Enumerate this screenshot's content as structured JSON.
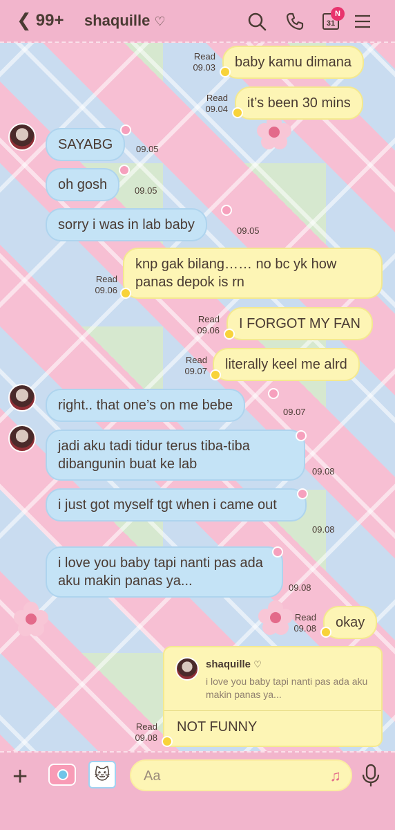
{
  "header": {
    "back_count": "99+",
    "contact_name": "shaquille",
    "calendar_day": "31",
    "calendar_badge": "N"
  },
  "messages": [
    {
      "id": "m1",
      "dir": "out",
      "text": "baby kamu dimana",
      "status": "Read",
      "time": "09.03"
    },
    {
      "id": "m2",
      "dir": "out",
      "text": "it’s been 30 mins",
      "status": "Read",
      "time": "09.04"
    },
    {
      "id": "m3",
      "dir": "in",
      "text": "SAYABG",
      "time": "09.05"
    },
    {
      "id": "m4",
      "dir": "in",
      "text": "oh gosh",
      "time": "09.05"
    },
    {
      "id": "m5",
      "dir": "in",
      "text": "sorry i was in lab baby",
      "time": "09.05"
    },
    {
      "id": "m6",
      "dir": "out",
      "text": "knp gak bilang…… no bc yk how panas depok is rn",
      "status": "Read",
      "time": "09.06"
    },
    {
      "id": "m7",
      "dir": "out",
      "text": "I FORGOT MY FAN",
      "status": "Read",
      "time": "09.06"
    },
    {
      "id": "m8",
      "dir": "out",
      "text": "literally keel me alrd",
      "status": "Read",
      "time": "09.07"
    },
    {
      "id": "m9",
      "dir": "in",
      "text": "right.. that one’s on me bebe",
      "time": "09.07"
    },
    {
      "id": "m10",
      "dir": "in",
      "text": "jadi aku tadi tidur terus tiba-tiba dibangunin buat ke lab",
      "time": "09.08"
    },
    {
      "id": "m11",
      "dir": "in",
      "text": "i just got myself tgt when i came out",
      "time": "09.08"
    },
    {
      "id": "m12",
      "dir": "in",
      "text": "i love you baby tapi nanti pas ada aku makin panas ya...",
      "time": "09.08"
    },
    {
      "id": "m13",
      "dir": "out",
      "text": "okay",
      "status": "Read",
      "time": "09.08"
    }
  ],
  "reply": {
    "quoted_name": "shaquille",
    "quoted_text": "i love you baby tapi nanti pas ada aku makin panas ya...",
    "text": "NOT FUNNY",
    "status": "Read",
    "time": "09.08"
  },
  "input": {
    "placeholder": "Aa"
  },
  "icons": {
    "back": "chevron-left-icon",
    "heart": "heart-icon",
    "search": "search-icon",
    "call": "phone-icon",
    "calendar": "calendar-icon",
    "menu": "menu-icon",
    "add": "plus-icon",
    "camera": "camera-icon",
    "sticker": "sticker-icon",
    "music": "music-icon",
    "mic": "microphone-icon"
  },
  "colors": {
    "header_bg": "#f2b5cc",
    "outgoing_bubble": "#fdf5b5",
    "incoming_bubble": "#c4e3f6",
    "badge": "#e8336d",
    "text": "#4a3b33"
  }
}
